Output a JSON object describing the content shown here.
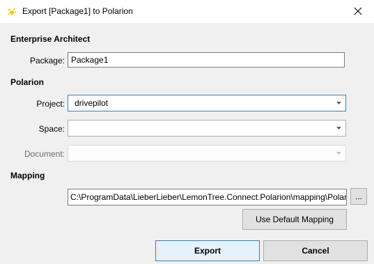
{
  "window": {
    "title": "Export [Package1] to Polarion"
  },
  "enterprise_architect": {
    "heading": "Enterprise Architect",
    "package_label": "Package:",
    "package_value": "Package1"
  },
  "polarion": {
    "heading": "Polarion",
    "project_label": "Project:",
    "project_value": "drivepilot",
    "space_label": "Space:",
    "space_value": "",
    "document_label": "Document:",
    "document_value": ""
  },
  "mapping": {
    "heading": "Mapping",
    "path_value": "C:\\ProgramData\\LieberLieber\\LemonTree.Connect.Polarion\\mapping\\Polarion",
    "browse_label": "...",
    "default_button_label": "Use Default Mapping"
  },
  "actions": {
    "export_label": "Export",
    "cancel_label": "Cancel"
  },
  "colors": {
    "accent": "#3c7fb1",
    "window_bg": "#f0f0f0",
    "button_bg": "#e1e1e1"
  }
}
